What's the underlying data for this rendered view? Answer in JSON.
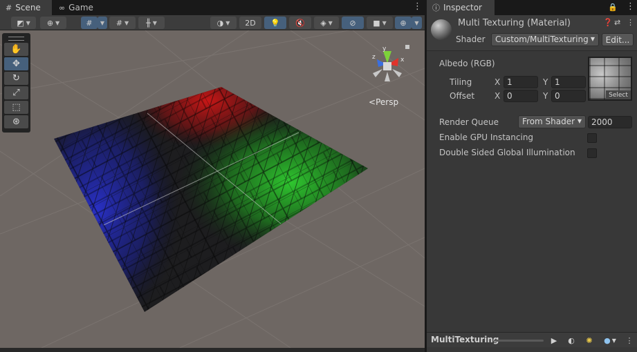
{
  "scene_panel": {
    "tabs": [
      {
        "label": "Scene",
        "icon": "grid-icon"
      },
      {
        "label": "Game",
        "icon": "gamepad-icon"
      }
    ],
    "toolbar": {
      "mode_2d_label": "2D"
    },
    "tools": [
      "hand-tool",
      "move-tool",
      "rotate-tool",
      "scale-tool",
      "rect-tool",
      "transform-tool"
    ],
    "gizmo": {
      "x_label": "x",
      "y_label": "y",
      "z_label": "z"
    },
    "persp_label": "Persp"
  },
  "inspector": {
    "tab_label": "Inspector",
    "material_title": "Multi Texturing (Material)",
    "shader_label": "Shader",
    "shader_value": "Custom/MultiTexturing",
    "edit_label": "Edit...",
    "albedo_label": "Albedo (RGB)",
    "albedo_select_label": "Select",
    "tiling": {
      "label": "Tiling",
      "x_axis": "X",
      "x": "1",
      "y_axis": "Y",
      "y": "1"
    },
    "offset": {
      "label": "Offset",
      "x_axis": "X",
      "x": "0",
      "y_axis": "Y",
      "y": "0"
    },
    "render_queue_label": "Render Queue",
    "render_queue_mode": "From Shader",
    "render_queue_value": "2000",
    "gpu_instancing_label": "Enable GPU Instancing",
    "gpu_instancing_checked": false,
    "double_sided_gi_label": "Double Sided Global Illumination",
    "double_sided_gi_checked": false,
    "preview_title": "MultiTexturing"
  },
  "colors": {
    "accent_selected": "#46607c",
    "viewport_bg": "#6e6763",
    "red_texture": "#c01818",
    "green_texture": "#1fb81f",
    "blue_texture": "#1a24c8"
  }
}
